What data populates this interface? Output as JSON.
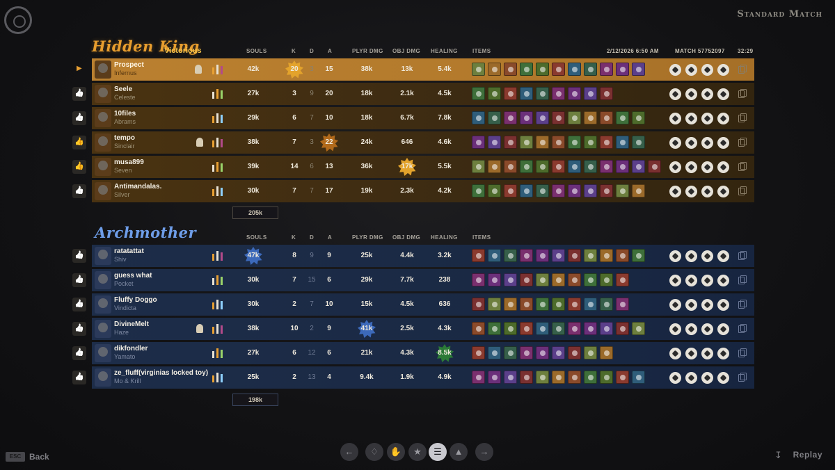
{
  "match_type": "Standard Match",
  "back_key": "ESC",
  "back_label": "Back",
  "replay_label": "Replay",
  "teams": [
    {
      "name": "Hidden King",
      "result": "Victorious",
      "headers": {
        "souls": "SOULS",
        "k": "K",
        "d": "D",
        "a": "A",
        "plyr_dmg": "PLYR DMG",
        "obj_dmg": "OBJ DMG",
        "healing": "HEALING",
        "items": "ITEMS",
        "date": "2/12/2026 6:50 AM",
        "match": "MATCH 57752097",
        "duration": "32:29"
      },
      "total_souls": "205k",
      "players": [
        {
          "player": "Prospect",
          "hero": "Infernus",
          "souls": "42k",
          "k": "20",
          "d": "3",
          "a": "15",
          "plyr_dmg": "38k",
          "obj_dmg": "13k",
          "healing": "5.4k",
          "items": 11
        },
        {
          "player": "Seele",
          "hero": "Celeste",
          "souls": "27k",
          "k": "3",
          "d": "9",
          "a": "20",
          "plyr_dmg": "18k",
          "obj_dmg": "2.1k",
          "healing": "4.5k",
          "items": 9
        },
        {
          "player": "10files",
          "hero": "Abrams",
          "souls": "29k",
          "k": "6",
          "d": "7",
          "a": "10",
          "plyr_dmg": "18k",
          "obj_dmg": "6.7k",
          "healing": "7.8k",
          "items": 11
        },
        {
          "player": "tempo",
          "hero": "Sinclair",
          "souls": "38k",
          "k": "7",
          "d": "3",
          "a": "22",
          "plyr_dmg": "24k",
          "obj_dmg": "646",
          "healing": "4.6k",
          "items": 11
        },
        {
          "player": "musa899",
          "hero": "Seven",
          "souls": "39k",
          "k": "14",
          "d": "6",
          "a": "13",
          "plyr_dmg": "36k",
          "obj_dmg": "17k",
          "healing": "5.5k",
          "items": 12
        },
        {
          "player": "Antimandalas.",
          "hero": "Silver",
          "souls": "30k",
          "k": "7",
          "d": "7",
          "a": "17",
          "plyr_dmg": "19k",
          "obj_dmg": "2.3k",
          "healing": "4.2k",
          "items": 11
        }
      ]
    },
    {
      "name": "Archmother",
      "headers": {
        "souls": "SOULS",
        "k": "K",
        "d": "D",
        "a": "A",
        "plyr_dmg": "PLYR DMG",
        "obj_dmg": "OBJ DMG",
        "healing": "HEALING",
        "items": "ITEMS"
      },
      "total_souls": "198k",
      "players": [
        {
          "player": "ratatattat",
          "hero": "Shiv",
          "souls": "47k",
          "k": "8",
          "d": "9",
          "a": "9",
          "plyr_dmg": "25k",
          "obj_dmg": "4.4k",
          "healing": "3.2k",
          "items": 11
        },
        {
          "player": "guess what",
          "hero": "Pocket",
          "souls": "30k",
          "k": "7",
          "d": "15",
          "a": "6",
          "plyr_dmg": "29k",
          "obj_dmg": "7.7k",
          "healing": "238",
          "items": 10
        },
        {
          "player": "Fluffy Doggo",
          "hero": "Vindicta",
          "souls": "30k",
          "k": "2",
          "d": "7",
          "a": "10",
          "plyr_dmg": "15k",
          "obj_dmg": "4.5k",
          "healing": "636",
          "items": 10
        },
        {
          "player": "DivineMelt",
          "hero": "Haze",
          "souls": "38k",
          "k": "10",
          "d": "2",
          "a": "9",
          "plyr_dmg": "41k",
          "obj_dmg": "2.5k",
          "healing": "4.3k",
          "items": 11
        },
        {
          "player": "dikfondler",
          "hero": "Yamato",
          "souls": "27k",
          "k": "6",
          "d": "12",
          "a": "6",
          "plyr_dmg": "21k",
          "obj_dmg": "4.3k",
          "healing": "8.5k",
          "items": 9
        },
        {
          "player": "ze_fluff(virginias locked toy)",
          "hero": "Mo & Krill",
          "souls": "25k",
          "k": "2",
          "d": "13",
          "a": "4",
          "plyr_dmg": "9.4k",
          "obj_dmg": "1.9k",
          "healing": "4.9k",
          "items": 11
        }
      ]
    }
  ],
  "colors": {
    "gold": "#e79d2e",
    "blue": "#6e9de8",
    "row_gold": "#3b2a12",
    "row_blue": "#1a2944"
  },
  "nav_icons": [
    "arrow-left-icon",
    "trophy-icon",
    "hand-icon",
    "flame-icon",
    "list-icon",
    "chart-icon",
    "arrow-right-icon"
  ]
}
